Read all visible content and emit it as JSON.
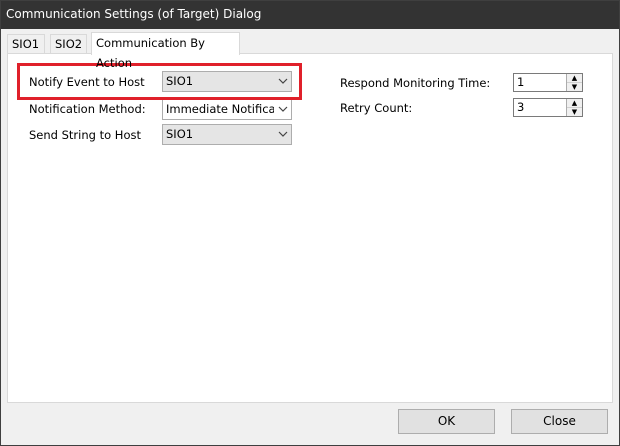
{
  "window": {
    "title": "Communication Settings (of Target) Dialog"
  },
  "tabs": [
    {
      "label": "SIO1"
    },
    {
      "label": "SIO2"
    },
    {
      "label": "Communication By Action"
    }
  ],
  "form": {
    "notify_event": {
      "label": "Notify Event to Host",
      "value": "SIO1"
    },
    "notification_method": {
      "label": "Notification Method:",
      "value": "Immediate Notificatic"
    },
    "send_string": {
      "label": "Send String to Host",
      "value": "SIO1"
    },
    "respond_monitoring": {
      "label": "Respond Monitoring Time:",
      "value": "1"
    },
    "retry_count": {
      "label": "Retry Count:",
      "value": "3"
    }
  },
  "buttons": {
    "ok": "OK",
    "close": "Close"
  },
  "colors": {
    "highlight": "#e0202a",
    "titlebar": "#333333"
  }
}
